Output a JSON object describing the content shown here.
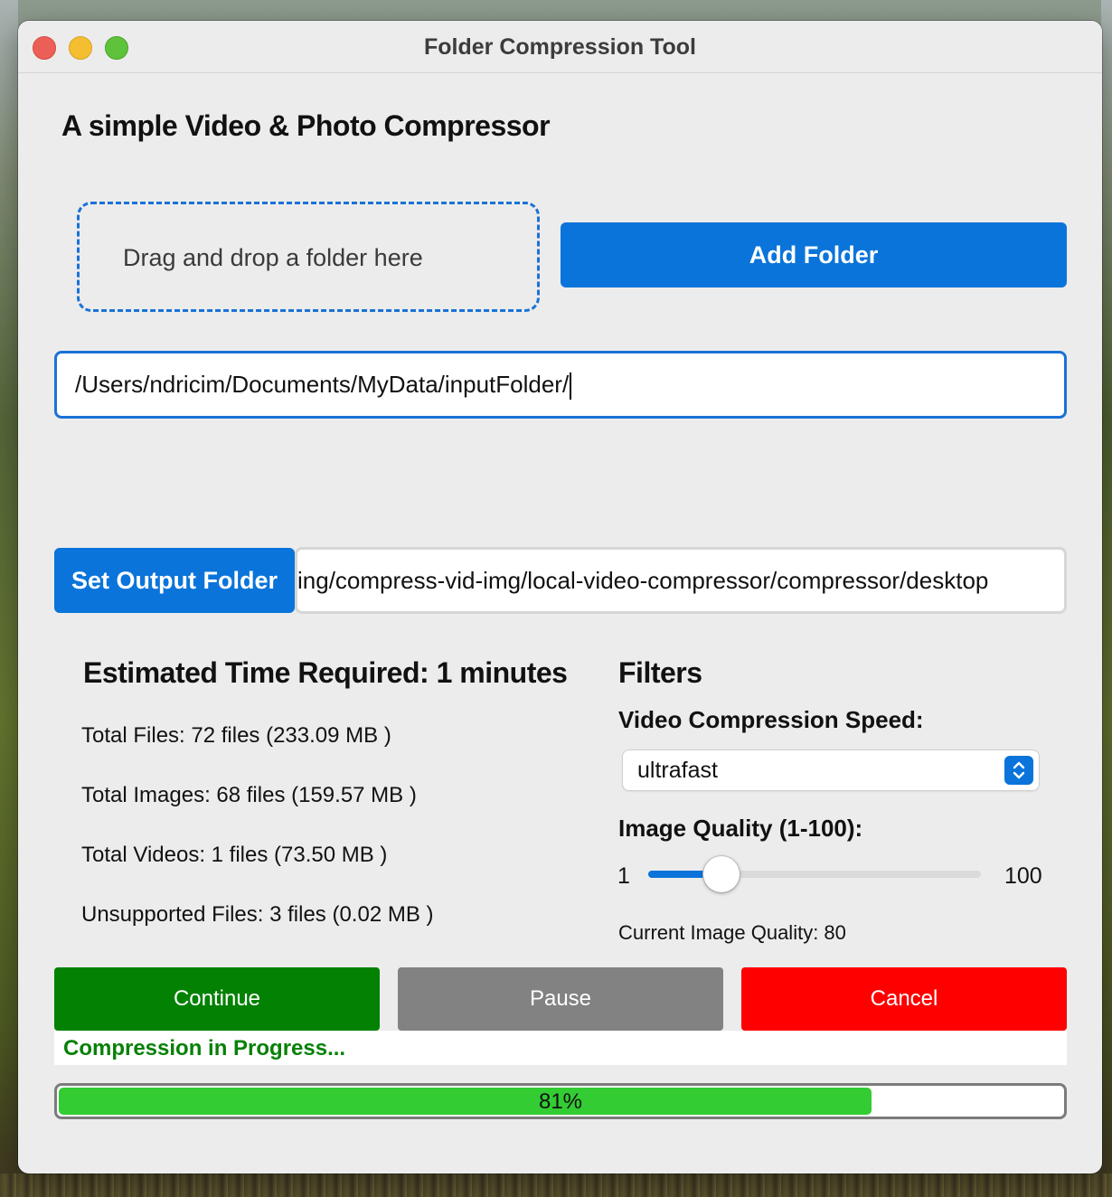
{
  "window": {
    "title": "Folder Compression Tool"
  },
  "header": {
    "heading": "A simple Video & Photo Compressor"
  },
  "input": {
    "dropzone_text": "Drag and drop a folder here",
    "add_folder_label": "Add Folder",
    "path_value": "/Users/ndricim/Documents/MyData/inputFolder/"
  },
  "output": {
    "set_output_label": "Set Output Folder",
    "path_value": "ing/compress-vid-img/local-video-compressor/compressor/desktop"
  },
  "stats": {
    "estimated_time": "Estimated Time Required: 1 minutes",
    "total_files": "Total Files: 72 files (233.09 MB )",
    "total_images": "Total Images: 68 files (159.57 MB )",
    "total_videos": "Total Videos: 1 files (73.50 MB )",
    "unsupported_files": "Unsupported Files: 3 files (0.02 MB )"
  },
  "filters": {
    "title": "Filters",
    "speed_label": "Video Compression Speed:",
    "speed_value": "ultrafast",
    "quality_label": "Image Quality (1-100):",
    "quality_min": "1",
    "quality_max": "100",
    "quality_value": 80,
    "current_quality_text": "Current Image Quality: 80"
  },
  "actions": {
    "continue_label": "Continue",
    "pause_label": "Pause",
    "cancel_label": "Cancel"
  },
  "status": {
    "text": "Compression in Progress...",
    "progress_percent": 81,
    "progress_label": "81%"
  },
  "colors": {
    "accent": "#0a74da",
    "continue": "#028102",
    "pause": "#828282",
    "cancel": "#fe0000",
    "progress_fill": "#33cc33",
    "status_text": "#078107"
  },
  "icons": {
    "close": "close-icon",
    "minimize": "minimize-icon",
    "maximize": "maximize-icon",
    "select_arrows": "chevron-up-down-icon"
  }
}
